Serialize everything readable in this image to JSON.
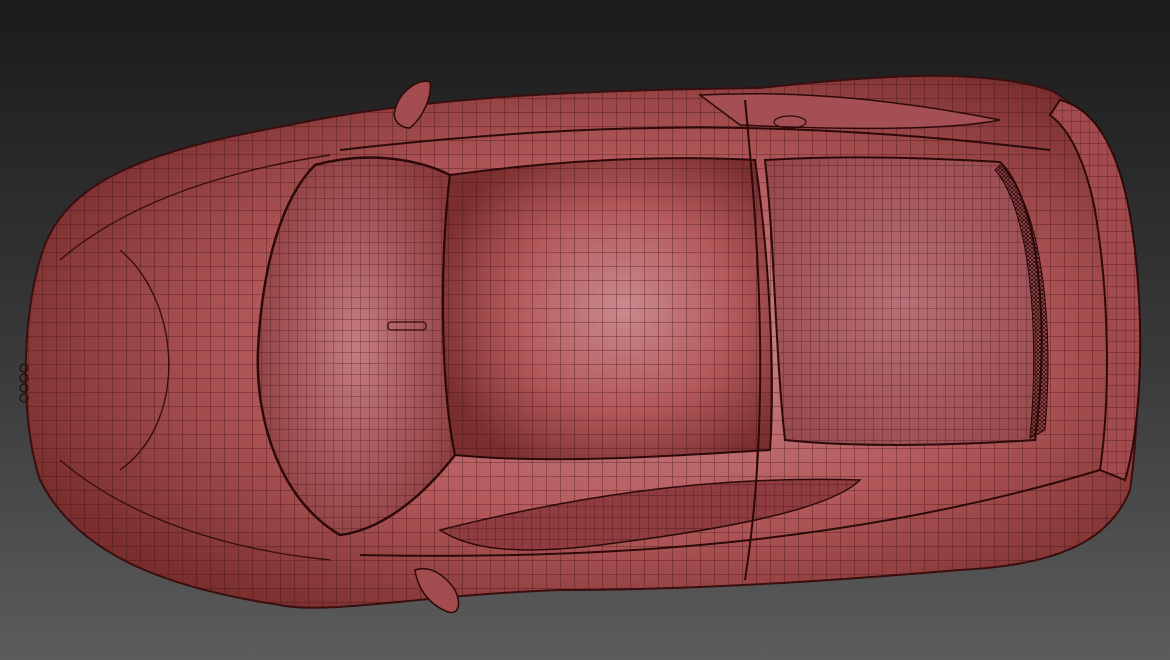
{
  "viewport": {
    "background_top": "#1b1b1b",
    "background_bottom": "#5c5c5c"
  },
  "model": {
    "subject": "car-wireframe-top-view",
    "body_color": "#b9585a",
    "body_highlight": "#c98a8f",
    "body_shadow": "#7a2e2e",
    "wire_color": "#3a0e0e"
  }
}
